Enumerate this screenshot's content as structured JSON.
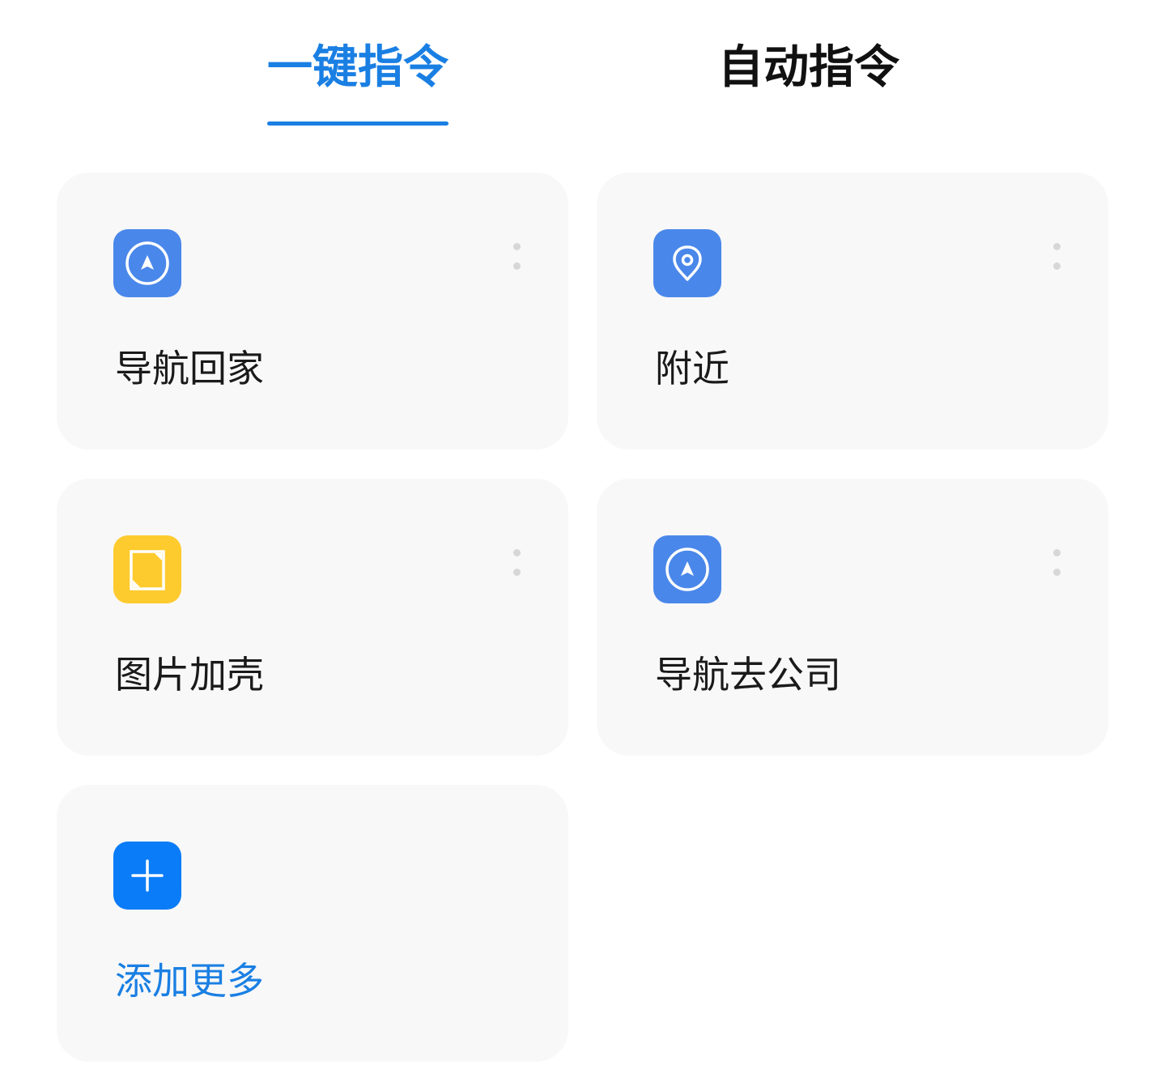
{
  "tabs": [
    {
      "label": "一键指令",
      "active": true
    },
    {
      "label": "自动指令",
      "active": false
    }
  ],
  "cards": [
    {
      "label": "导航回家",
      "icon": "navigation-arrow-icon",
      "icon_color": "#4a87ea",
      "has_menu": true
    },
    {
      "label": "附近",
      "icon": "location-pin-icon",
      "icon_color": "#4a87ea",
      "has_menu": true
    },
    {
      "label": "图片加壳",
      "icon": "image-frame-icon",
      "icon_color": "#fecb2f",
      "has_menu": true
    },
    {
      "label": "导航去公司",
      "icon": "navigation-arrow-icon",
      "icon_color": "#4a87ea",
      "has_menu": true
    }
  ],
  "add_card": {
    "label": "添加更多",
    "icon": "plus-icon",
    "icon_color": "#0a7cf8"
  },
  "colors": {
    "accent": "#1a7fe3",
    "card_background": "#f8f8f8",
    "text": "#111111"
  }
}
